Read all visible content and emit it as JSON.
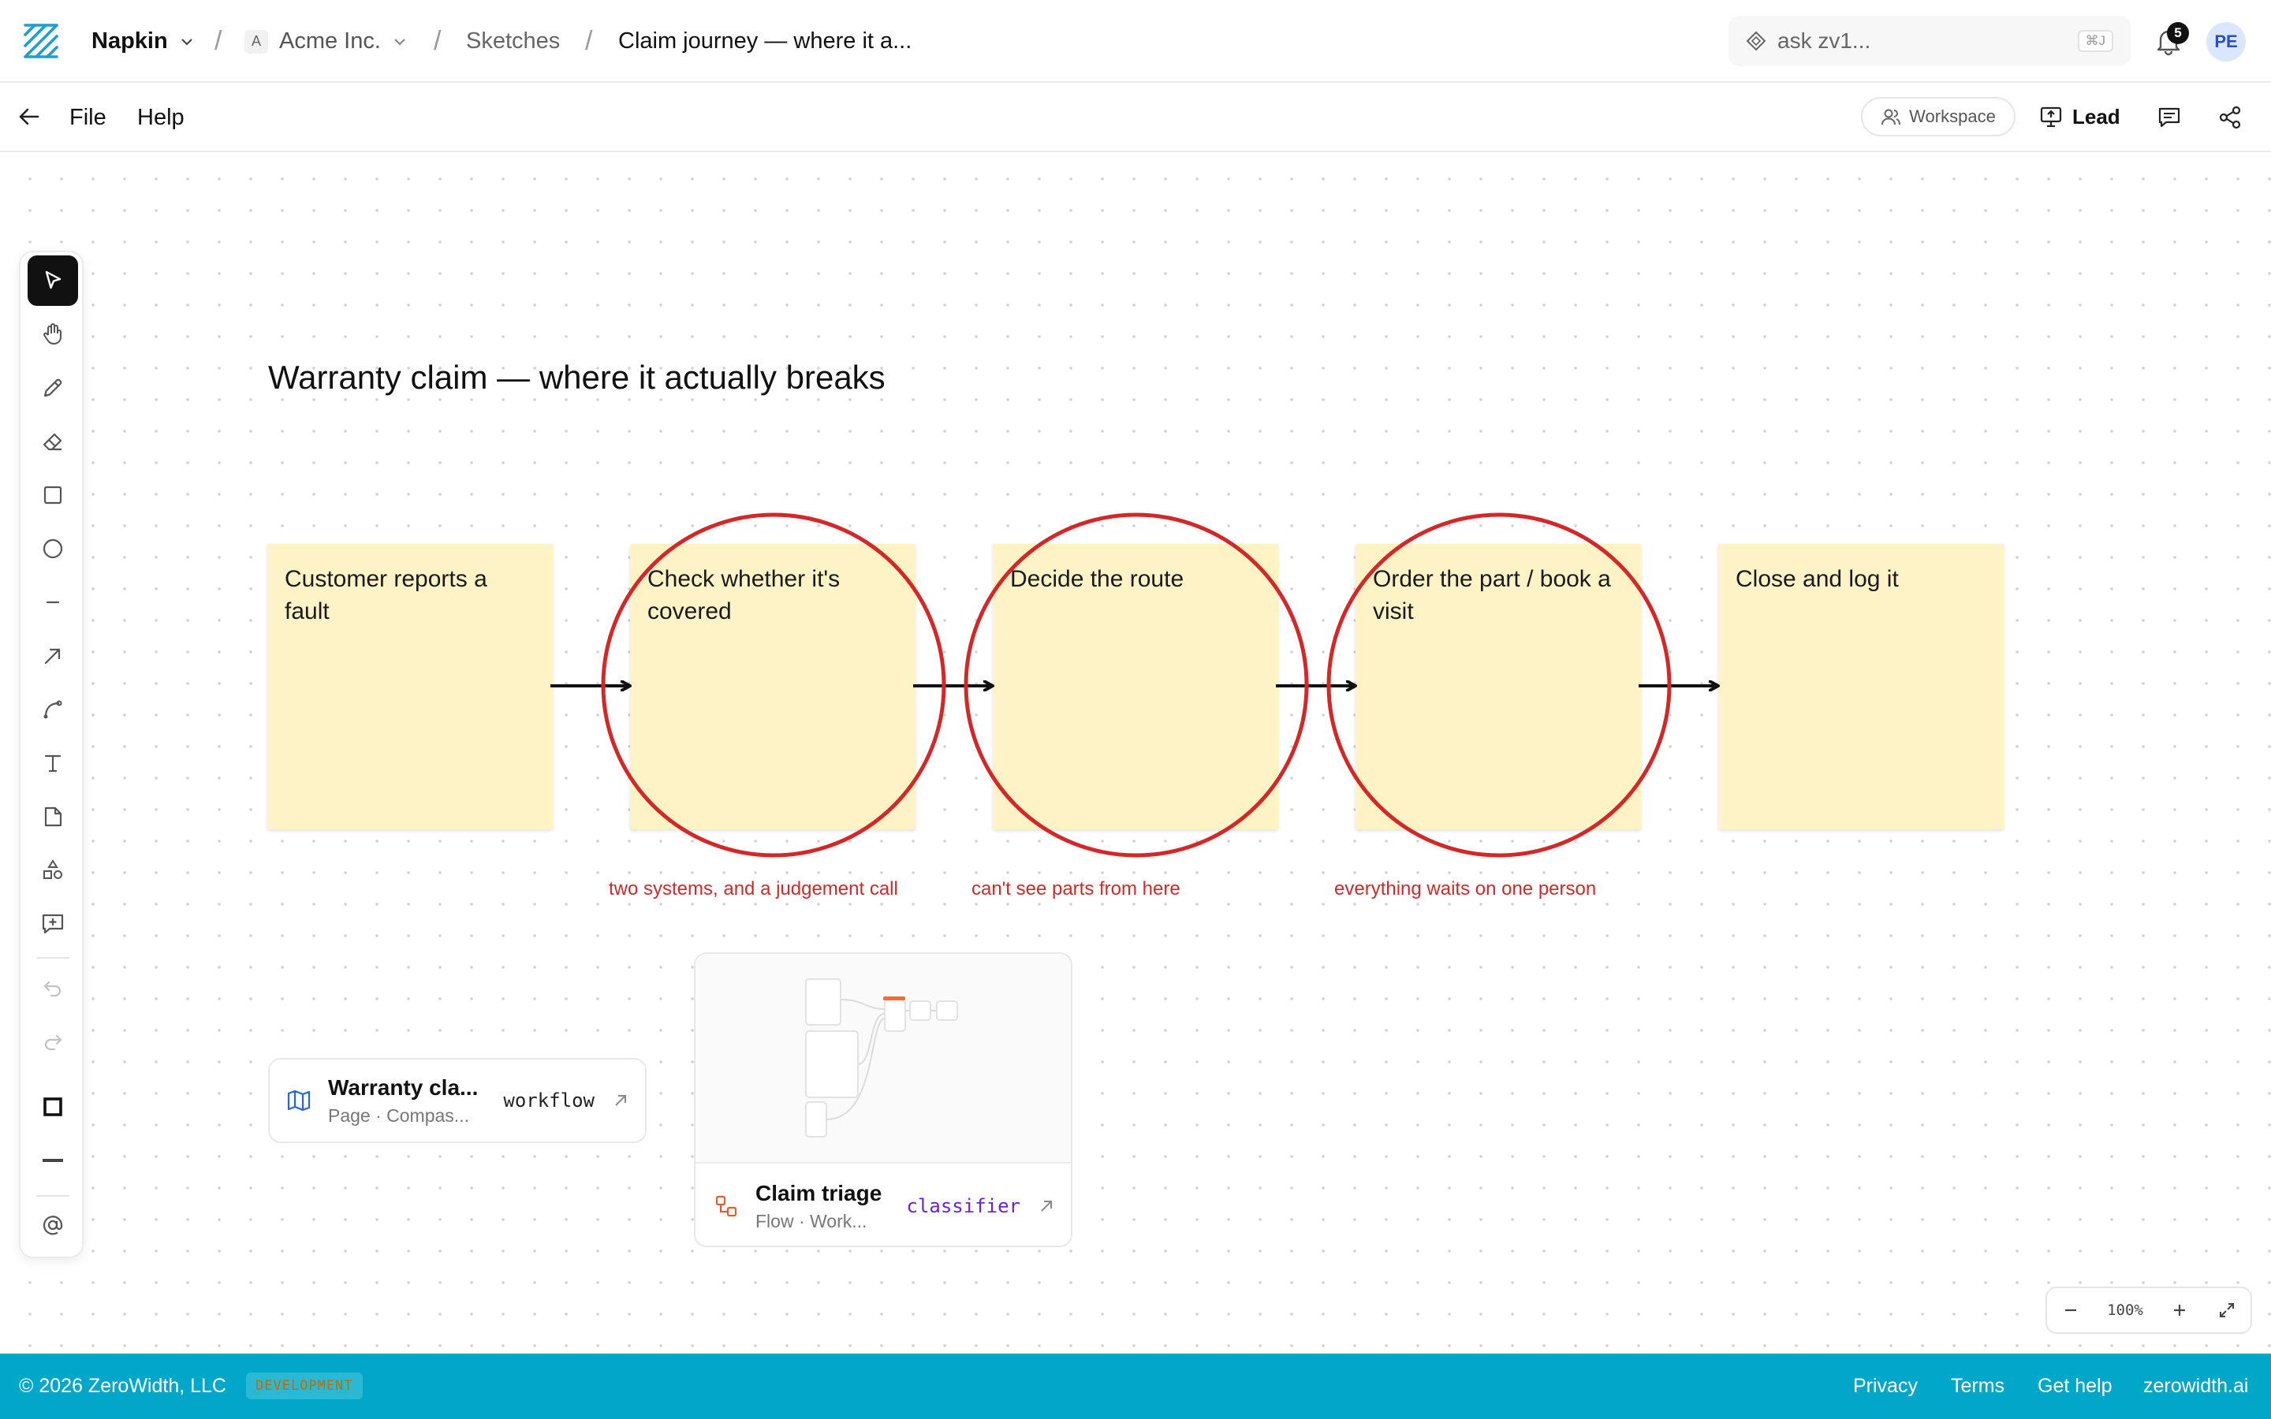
{
  "header": {
    "workspace_name": "Napkin",
    "org_initial": "A",
    "org_name": "Acme Inc.",
    "section": "Sketches",
    "page_title": "Claim journey — where it a...",
    "search_placeholder": "ask zv1...",
    "search_shortcut": "⌘J",
    "notification_count": "5",
    "avatar_initials": "PE"
  },
  "menubar": {
    "file": "File",
    "help": "Help",
    "workspace_button": "Workspace",
    "lead_button": "Lead"
  },
  "canvas": {
    "title": "Warranty claim — where it actually breaks",
    "stickies": [
      {
        "text": "Customer reports a fault"
      },
      {
        "text": "Check whether it's covered"
      },
      {
        "text": "Decide the route"
      },
      {
        "text": "Order the part / book a visit"
      },
      {
        "text": "Close and log it"
      }
    ],
    "annotations": [
      "two systems, and a judgement call",
      "can't see parts from here",
      "everything waits on one person"
    ],
    "annotation_color": "#d42828",
    "sticky_color": "#fdf3c7",
    "link_card": {
      "title": "Warranty cla...",
      "subtitle": "Page · Compas...",
      "tag": "workflow",
      "icon": "map-icon"
    },
    "flow_card": {
      "title": "Claim triage",
      "subtitle": "Flow · Work...",
      "tag": "classifier",
      "tag_color": "#6b21d8",
      "icon": "flow-icon"
    }
  },
  "zoom": {
    "level": "100%"
  },
  "footer": {
    "copyright": "© 2026 ZeroWidth, LLC",
    "env_badge": "DEVELOPMENT",
    "links": [
      "Privacy",
      "Terms",
      "Get help",
      "zerowidth.ai"
    ],
    "color": "#00a7c9"
  }
}
